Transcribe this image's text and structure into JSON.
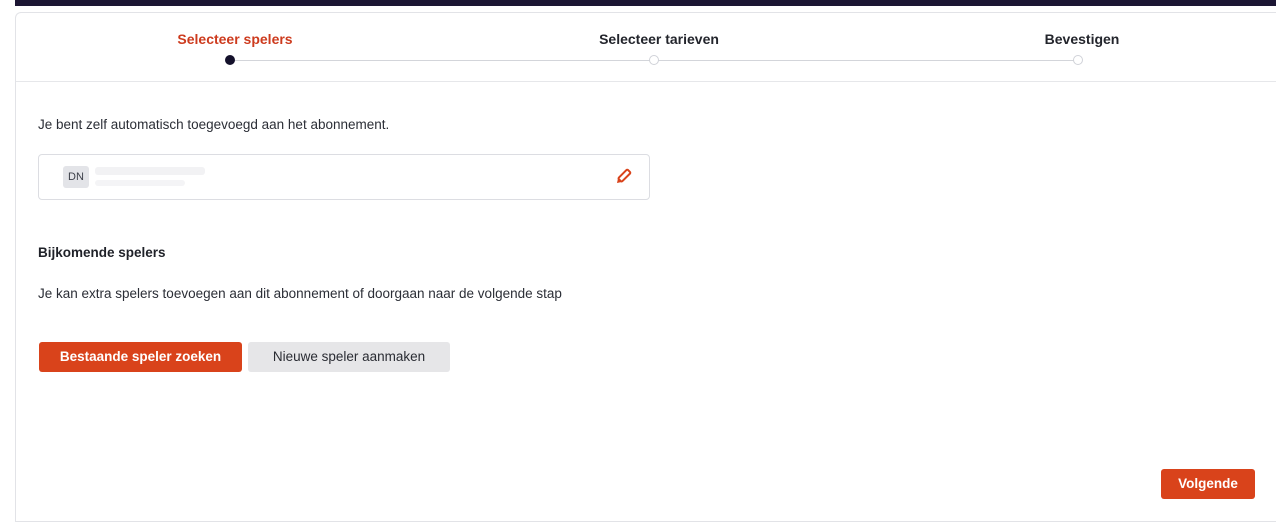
{
  "stepper": {
    "steps": [
      {
        "label": "Selecteer spelers",
        "state": "active"
      },
      {
        "label": "Selecteer tarieven",
        "state": "inactive"
      },
      {
        "label": "Bevestigen",
        "state": "inactive"
      }
    ]
  },
  "main": {
    "intro_text": "Je bent zelf automatisch toegevoegd aan het abonnement.",
    "player": {
      "initials": "DN",
      "edit_icon": "pencil-icon"
    },
    "additional": {
      "title": "Bijkomende spelers",
      "text": "Je kan extra spelers toevoegen aan dit abonnement of doorgaan naar de volgende stap"
    },
    "buttons": {
      "search_existing": "Bestaande speler zoeken",
      "create_new": "Nieuwe speler aanmaken"
    }
  },
  "footer": {
    "next_label": "Volgende"
  },
  "colors": {
    "accent": "#d9431b",
    "active_step_text": "#cd3b1e",
    "active_dot": "#14112b",
    "topbar": "#1c1633"
  }
}
